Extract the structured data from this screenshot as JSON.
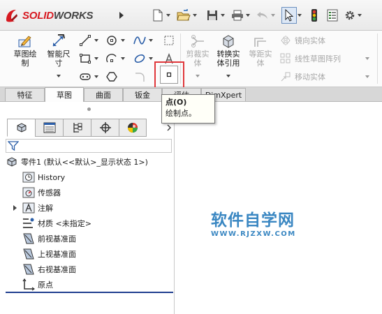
{
  "app": {
    "brand_bold": "SOLID",
    "brand_light": "WORKS"
  },
  "colors": {
    "brand_red": "#d71920",
    "tab_active": "#fdfdfd",
    "highlight_red": "#e0373b",
    "watermark_blue": "#3a87c2"
  },
  "quick_access": {
    "items": [
      {
        "name": "new-document",
        "icon": "new-document-icon"
      },
      {
        "name": "open",
        "icon": "open-folder-icon"
      },
      {
        "name": "save",
        "icon": "save-icon"
      },
      {
        "name": "print",
        "icon": "print-icon"
      },
      {
        "name": "undo",
        "icon": "undo-icon"
      },
      {
        "name": "select",
        "icon": "select-cursor-icon"
      },
      {
        "name": "rebuild",
        "icon": "traffic-light-icon"
      },
      {
        "name": "file-properties",
        "icon": "file-properties-icon"
      },
      {
        "name": "options",
        "icon": "gear-icon"
      }
    ]
  },
  "ribbon": {
    "sketch": {
      "label": "草图绘\n制"
    },
    "smart_dim": {
      "label": "智能尺\n寸"
    },
    "trim": {
      "label": "剪裁实\n体"
    },
    "convert": {
      "label": "转换实\n体引用"
    },
    "offset": {
      "label": "等距实\n体"
    },
    "mirror": {
      "label": "镜向实体"
    },
    "linear_pattern": {
      "label": "线性草图阵列"
    },
    "move": {
      "label": "移动实体"
    }
  },
  "tabs": [
    {
      "label": "特征",
      "active": false
    },
    {
      "label": "草图",
      "active": true
    },
    {
      "label": "曲面",
      "active": false
    },
    {
      "label": "钣金",
      "active": false
    },
    {
      "label": "评估",
      "active": false
    },
    {
      "label": "DimXpert",
      "active": false
    }
  ],
  "tooltip": {
    "title": "点(O)",
    "description": "绘制点。"
  },
  "tree": {
    "root": "零件1 (默认<<默认>_显示状态 1>)",
    "items": [
      {
        "label": "History",
        "icon": "history-icon",
        "expandable": false
      },
      {
        "label": "传感器",
        "icon": "sensor-icon",
        "expandable": false
      },
      {
        "label": "注解",
        "icon": "annotation-icon",
        "expandable": true
      },
      {
        "label": "材质 <未指定>",
        "icon": "material-icon",
        "expandable": false
      },
      {
        "label": "前视基准面",
        "icon": "plane-icon",
        "expandable": false
      },
      {
        "label": "上视基准面",
        "icon": "plane-icon",
        "expandable": false
      },
      {
        "label": "右视基准面",
        "icon": "plane-icon",
        "expandable": false
      },
      {
        "label": "原点",
        "icon": "origin-icon",
        "expandable": false
      }
    ]
  },
  "watermark": {
    "title": "软件自学网",
    "url": "WWW.RJZXW.COM"
  }
}
